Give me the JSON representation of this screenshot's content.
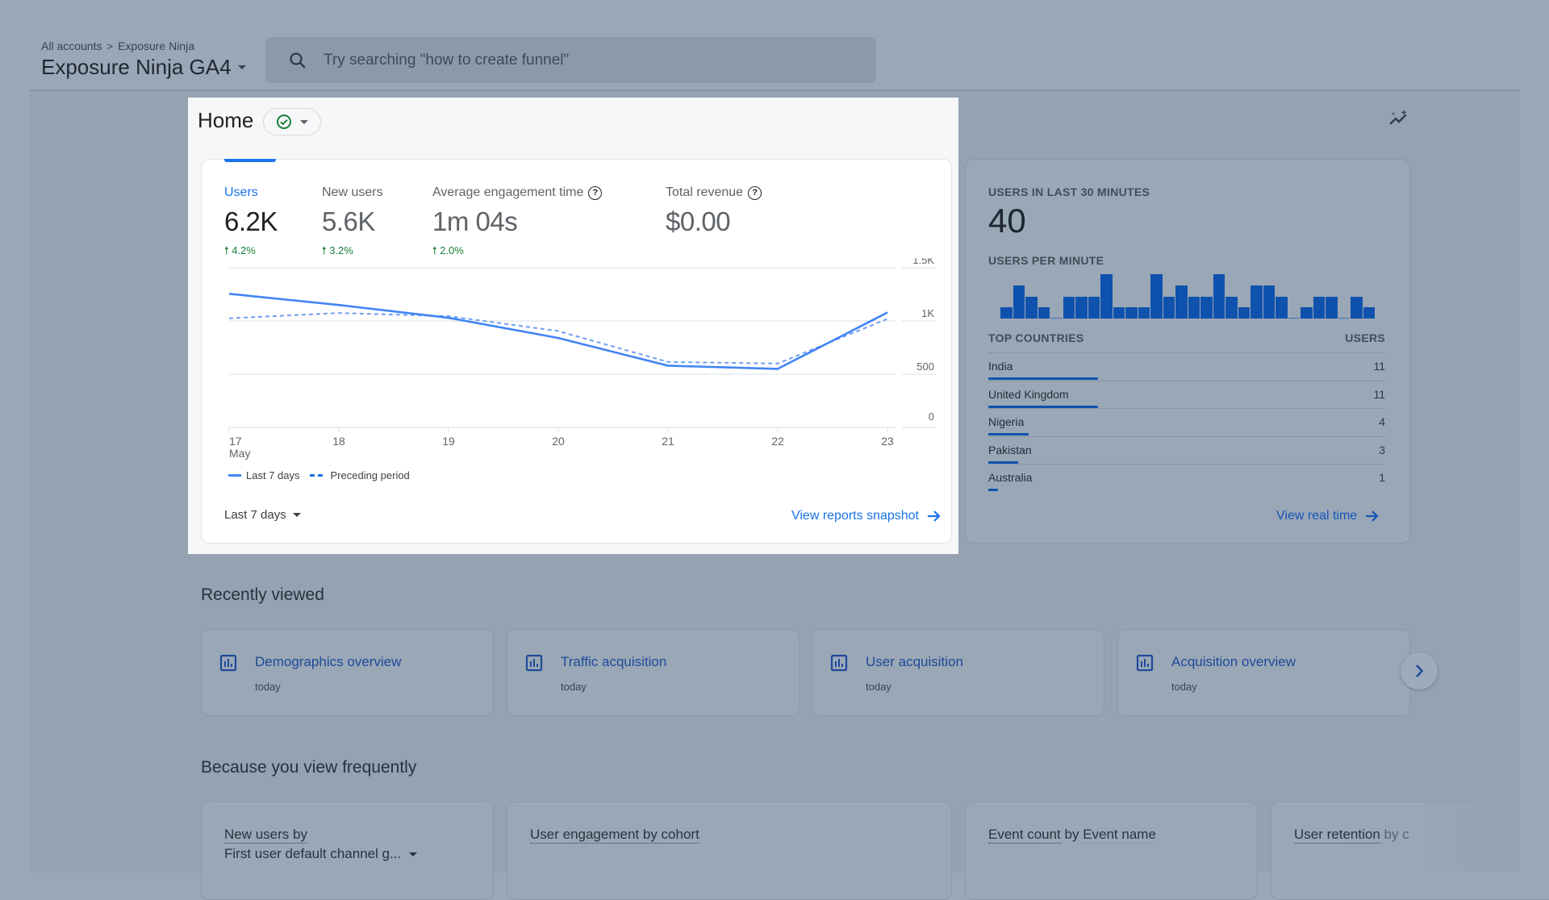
{
  "header": {
    "breadcrumb": [
      "All accounts",
      "Exposure Ninja"
    ],
    "breadcrumb_separator": ">",
    "property_title": "Exposure Ninja GA4",
    "search_placeholder": "Try searching \"how to create funnel\""
  },
  "home": {
    "title": "Home",
    "status_icon": "check-circle-icon",
    "insights_icon": "insights-sparkle-icon"
  },
  "overview": {
    "metrics": [
      {
        "label": "Users",
        "value": "6.2K",
        "change": "4.2%",
        "direction": "up",
        "active": true,
        "help": false
      },
      {
        "label": "New users",
        "value": "5.6K",
        "change": "3.2%",
        "direction": "up",
        "active": false,
        "help": false
      },
      {
        "label": "Average engagement time",
        "value": "1m 04s",
        "change": "2.0%",
        "direction": "up",
        "active": false,
        "help": true
      },
      {
        "label": "Total revenue",
        "value": "$0.00",
        "change": "",
        "direction": "",
        "active": false,
        "help": true
      }
    ],
    "legend": {
      "current": "Last 7 days",
      "previous": "Preceding period"
    },
    "date_range": "Last 7 days",
    "link": "View reports snapshot"
  },
  "chart_data": {
    "type": "line",
    "title": "Users",
    "x": [
      "17",
      "18",
      "19",
      "20",
      "21",
      "22",
      "23"
    ],
    "x_sublabel": "May",
    "y_ticks": [
      "0",
      "500",
      "1K",
      "1.5K"
    ],
    "ylim": [
      0,
      1500
    ],
    "grid": true,
    "legend_position": "bottom-left",
    "series": [
      {
        "name": "Last 7 days",
        "style": "solid",
        "color": "#4285f4",
        "values": [
          1255,
          1150,
          1030,
          840,
          580,
          550,
          1080
        ]
      },
      {
        "name": "Preceding period",
        "style": "dashed",
        "color": "#6f9ef5",
        "values": [
          1025,
          1075,
          1045,
          905,
          615,
          600,
          1020
        ]
      }
    ]
  },
  "realtime": {
    "users_label": "USERS IN LAST 30 MINUTES",
    "users_count": "40",
    "per_minute_label": "USERS PER MINUTE",
    "per_minute_values": [
      1,
      3,
      2,
      1,
      0,
      2,
      2,
      2,
      4,
      1,
      1,
      1,
      4,
      2,
      3,
      2,
      2,
      4,
      2,
      1,
      3,
      3,
      2,
      0,
      1,
      2,
      2,
      0,
      2,
      1
    ],
    "countries_header": "TOP COUNTRIES",
    "users_header": "USERS",
    "countries": [
      {
        "name": "India",
        "users": "11",
        "share": 1.0
      },
      {
        "name": "United Kingdom",
        "users": "11",
        "share": 1.0
      },
      {
        "name": "Nigeria",
        "users": "4",
        "share": 0.364
      },
      {
        "name": "Pakistan",
        "users": "3",
        "share": 0.273
      },
      {
        "name": "Australia",
        "users": "1",
        "share": 0.09
      }
    ],
    "link": "View real time"
  },
  "recently_viewed": {
    "title": "Recently viewed",
    "items": [
      {
        "title": "Demographics overview",
        "when": "today"
      },
      {
        "title": "Traffic acquisition",
        "when": "today"
      },
      {
        "title": "User acquisition",
        "when": "today"
      },
      {
        "title": "Acquisition overview",
        "when": "today"
      }
    ]
  },
  "frequent": {
    "title": "Because you view frequently",
    "cards": [
      {
        "title_parts": [
          "New users by"
        ],
        "dropdown": "First user default channel g..."
      },
      {
        "title_parts": [
          "User engagement by cohort"
        ]
      },
      {
        "title_parts": [
          "Event count",
          " by ",
          "Event name"
        ]
      },
      {
        "title_parts": [
          "User retention",
          " by c"
        ]
      }
    ]
  },
  "colors": {
    "accent": "#1a73e8",
    "positive": "#188038",
    "bar": "#0f52ad"
  }
}
